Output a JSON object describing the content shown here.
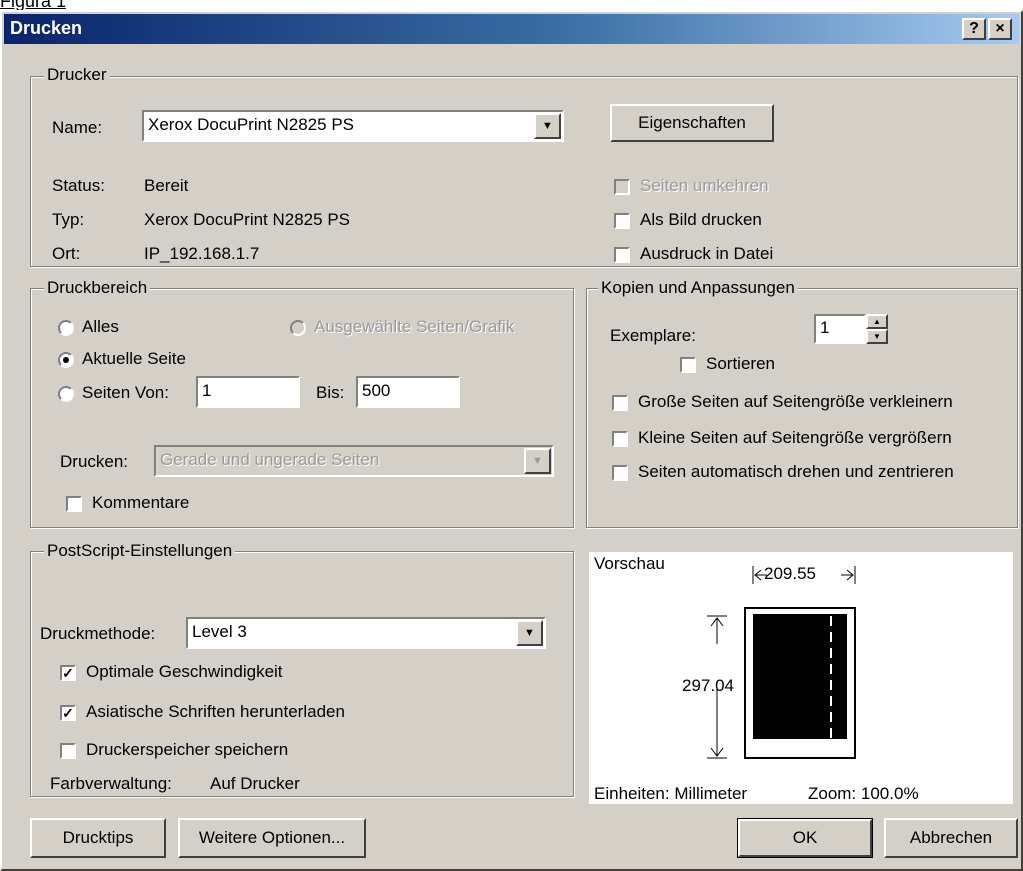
{
  "caption": "Figura 1",
  "window": {
    "title": "Drucken",
    "help_label": "?",
    "close_label": "×"
  },
  "printer": {
    "group_label": "Drucker",
    "name_label": "Name:",
    "name_value": "Xerox DocuPrint N2825 PS",
    "properties_button": "Eigenschaften",
    "status_label": "Status:",
    "status_value": "Bereit",
    "type_label": "Typ:",
    "type_value": "Xerox DocuPrint N2825 PS",
    "location_label": "Ort:",
    "location_value": "IP_192.168.1.7",
    "reverse_pages": {
      "label": "Seiten umkehren",
      "checked": false,
      "enabled": false
    },
    "print_as_image": {
      "label": "Als Bild drucken",
      "checked": false
    },
    "print_to_file": {
      "label": "Ausdruck in Datei",
      "checked": false
    }
  },
  "range": {
    "group_label": "Druckbereich",
    "all": {
      "label": "Alles",
      "selected": false
    },
    "selected_pages": {
      "label": "Ausgewählte Seiten/Grafik",
      "selected": false,
      "enabled": false
    },
    "current_page": {
      "label": "Aktuelle Seite",
      "selected": true
    },
    "pages": {
      "label": "Seiten Von:",
      "selected": false
    },
    "from_value": "1",
    "to_label": "Bis:",
    "to_value": "500",
    "print_label": "Drucken:",
    "print_value": "Gerade und ungerade Seiten",
    "comments": {
      "label": "Kommentare",
      "checked": false
    }
  },
  "copies": {
    "group_label": "Kopien und Anpassungen",
    "copies_label": "Exemplare:",
    "copies_value": "1",
    "collate": {
      "label": "Sortieren",
      "checked": false
    },
    "shrink": {
      "label": "Große Seiten auf Seitengröße verkleinern",
      "checked": false
    },
    "expand": {
      "label": "Kleine Seiten auf Seitengröße vergrößern",
      "checked": false
    },
    "autorotate": {
      "label": "Seiten automatisch drehen und zentrieren",
      "checked": false
    }
  },
  "postscript": {
    "group_label": "PostScript-Einstellungen",
    "method_label": "Druckmethode:",
    "method_value": "Level 3",
    "optimize_speed": {
      "label": "Optimale Geschwindigkeit",
      "checked": true
    },
    "download_asian_fonts": {
      "label": "Asiatische Schriften herunterladen",
      "checked": true
    },
    "save_printer_memory": {
      "label": "Druckerspeicher speichern",
      "checked": false
    },
    "color_mgmt_label": "Farbverwaltung:",
    "color_mgmt_value": "Auf Drucker"
  },
  "preview": {
    "label": "Vorschau",
    "width_value": "209.55",
    "height_value": "297.04",
    "units_label": "Einheiten: Millimeter",
    "zoom_label": "Zoom: 100.0%"
  },
  "buttons": {
    "tips": "Drucktips",
    "more_options": "Weitere Optionen...",
    "ok": "OK",
    "cancel": "Abbrechen"
  }
}
